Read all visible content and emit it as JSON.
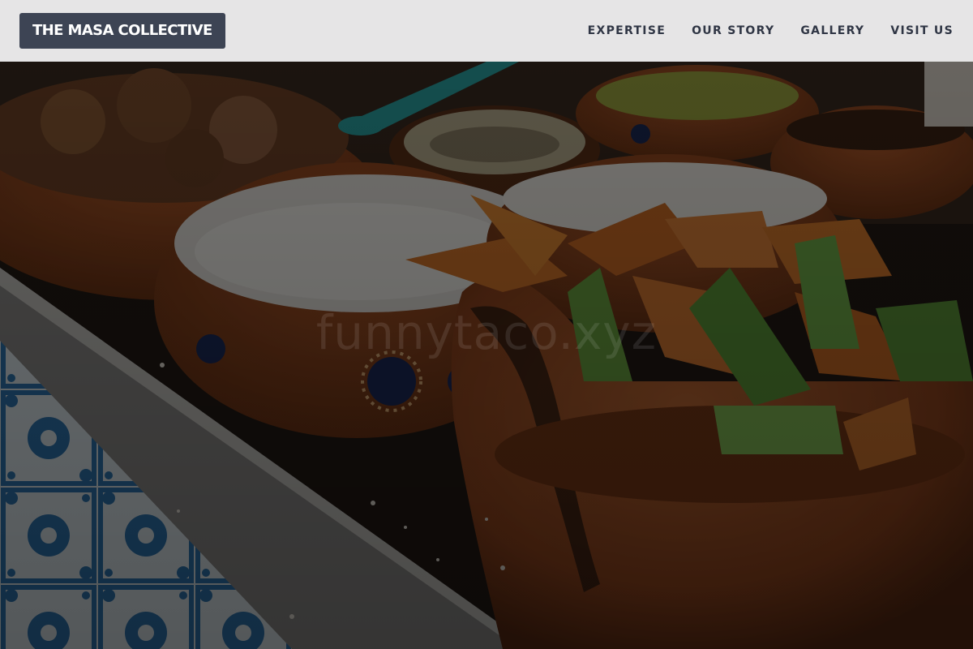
{
  "header": {
    "brand": "THE MASA COLLECTIVE",
    "nav": [
      {
        "label": "EXPERTISE"
      },
      {
        "label": "OUR STORY"
      },
      {
        "label": "GALLERY"
      },
      {
        "label": "VISIT US"
      }
    ]
  },
  "hero": {
    "watermark": "funnytaco.xyz",
    "overlay_color": "#000000"
  },
  "colors": {
    "brand_bg": "#3d4454",
    "nav_text": "#2f3544",
    "header_bg": "#f6f6f7",
    "terracotta": "#a4562a",
    "tile_blue": "#2f78b4"
  }
}
